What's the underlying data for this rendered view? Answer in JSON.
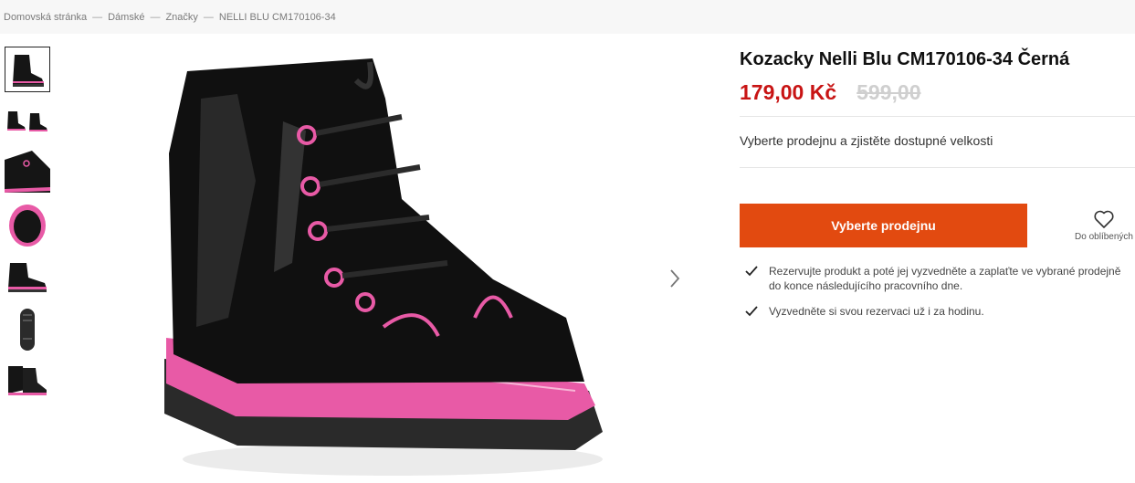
{
  "breadcrumb": {
    "items": [
      "Domovská stránka",
      "Dámské",
      "Značky",
      "NELLI BLU CM170106-34"
    ],
    "separator": "—"
  },
  "gallery": {
    "thumbnails": [
      {
        "icon": "boot-side-view-thumbnail",
        "active": true
      },
      {
        "icon": "boot-pair-thumbnail",
        "active": false
      },
      {
        "icon": "boot-closeup-thumbnail",
        "active": false
      },
      {
        "icon": "boot-inside-thumbnail",
        "active": false
      },
      {
        "icon": "boot-side-thumbnail",
        "active": false
      },
      {
        "icon": "boot-sole-thumbnail",
        "active": false
      },
      {
        "icon": "boot-pair-back-thumbnail",
        "active": false
      }
    ],
    "next_icon": "chevron-right-icon"
  },
  "product": {
    "title": "Kozacky Nelli Blu CM170106-34 Černá",
    "price_current": "179,00 Kč",
    "price_old": "599,00",
    "store_prompt": "Vyberte prodejnu a zjistěte dostupné velkosti",
    "select_store_button": "Vyberte prodejnu",
    "favorite_label": "Do oblíbených",
    "benefits": [
      "Rezervujte produkt a poté jej vyzvedněte a zaplaťte ve vybrané prodejně do konce následujícího pracovního dne.",
      "Vyzvedněte si svou rezervaci už i za hodinu."
    ]
  },
  "colors": {
    "accent_button": "#e24a10",
    "price_red": "#c81414",
    "old_price_gray": "#cfcfcf",
    "boot_pink": "#e85aa6",
    "boot_black": "#111111"
  }
}
